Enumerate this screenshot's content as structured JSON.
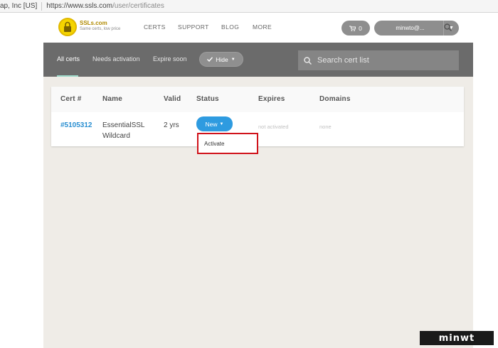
{
  "browser": {
    "org": "ap, Inc [US]",
    "url_prefix": "https://www.ssls.com",
    "url_path": "/user/certificates"
  },
  "header": {
    "brand": "SSLs.com",
    "tagline": "Same certs, low price",
    "nav": [
      "CERTS",
      "SUPPORT",
      "BLOG",
      "MORE"
    ],
    "cart_count": "0",
    "user_name": "minwto@..."
  },
  "toolbar": {
    "tabs": [
      "All certs",
      "Needs activation",
      "Expire soon"
    ],
    "active_tab": "All certs",
    "hide_label": "Hide",
    "search_placeholder": "Search cert list"
  },
  "table": {
    "headers": [
      "Cert #",
      "Name",
      "Valid",
      "Status",
      "Expires",
      "Domains"
    ],
    "rows": [
      {
        "cert": "#5105312",
        "name_line1": "EssentialSSL",
        "name_line2": "Wildcard",
        "valid": "2 yrs",
        "status": "New",
        "expires": "not activated",
        "domains": "none"
      }
    ]
  },
  "dropdown": {
    "item": "Activate"
  },
  "watermark": "minwt",
  "colors": {
    "accent_blue": "#2e9be0",
    "highlight_red": "#d0121a",
    "toolbar_gray": "#6b6b6b",
    "tab_underline": "#9cd9c9"
  }
}
